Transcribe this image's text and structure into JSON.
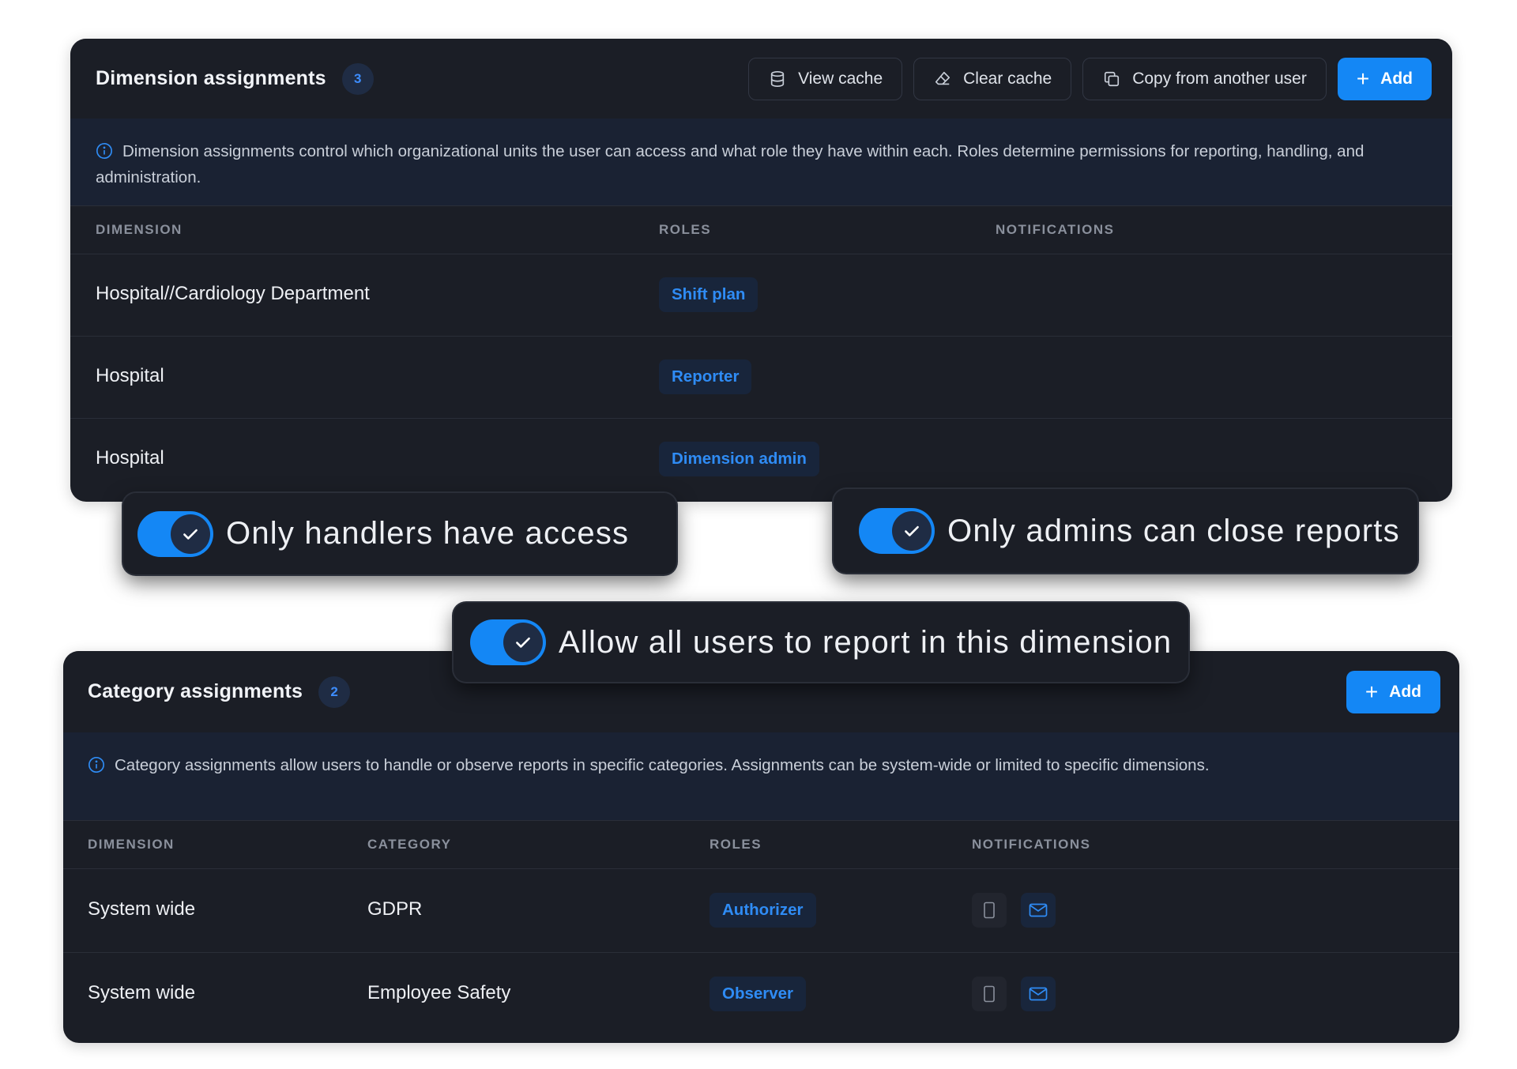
{
  "colors": {
    "panel_bg": "#1b1e26",
    "info_bg": "#1a2233",
    "accent": "#1487f5",
    "badge_text": "#2f8cf5"
  },
  "dimension_panel": {
    "title": "Dimension assignments",
    "count": "3",
    "buttons": {
      "view_cache": "View cache",
      "clear_cache": "Clear cache",
      "copy_from_user": "Copy from another user",
      "add": "Add"
    },
    "info": "Dimension assignments control which organizational units the user can access and what role they have within each. Roles determine permissions for reporting, handling, and administration.",
    "columns": [
      "DIMENSION",
      "ROLES",
      "NOTIFICATIONS"
    ],
    "rows": [
      {
        "dimension": "Hospital//Cardiology Department",
        "role": "Shift plan"
      },
      {
        "dimension": "Hospital",
        "role": "Reporter"
      },
      {
        "dimension": "Hospital",
        "role": "Dimension admin"
      }
    ]
  },
  "toggles": [
    {
      "label": "Only handlers have access",
      "checked": true
    },
    {
      "label": "Only admins can close reports",
      "checked": true
    },
    {
      "label": "Allow all users to report in this dimension",
      "checked": true
    }
  ],
  "category_panel": {
    "title": "Category assignments",
    "count": "2",
    "buttons": {
      "add": "Add"
    },
    "info": "Category assignments allow users to handle or observe reports in specific categories. Assignments can be system-wide or limited to specific dimensions.",
    "columns": [
      "DIMENSION",
      "CATEGORY",
      "ROLES",
      "NOTIFICATIONS"
    ],
    "rows": [
      {
        "dimension": "System wide",
        "category": "GDPR",
        "role": "Authorizer",
        "notifications": [
          "phone-icon",
          "mail-icon"
        ]
      },
      {
        "dimension": "System wide",
        "category": "Employee Safety",
        "role": "Observer",
        "notifications": [
          "phone-icon",
          "mail-icon"
        ]
      }
    ]
  }
}
